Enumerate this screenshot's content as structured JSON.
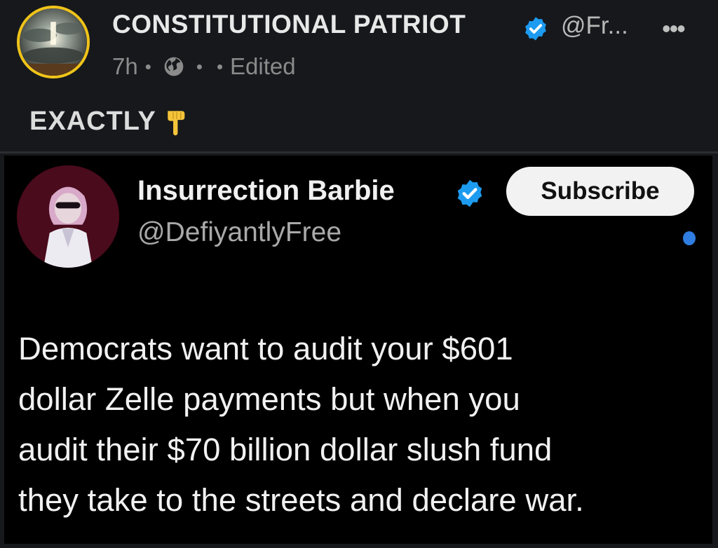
{
  "post": {
    "author_name": "CONSTITUTIONAL PATRIOT",
    "handle": "@Fr...",
    "time": "7h",
    "status": "Edited",
    "text": "EXACTLY",
    "icons": [
      "avatar",
      "verified-badge-icon",
      "more-icon",
      "globe-icon",
      "pointing-down-hand-icon"
    ]
  },
  "embed": {
    "author_name": "Insurrection Barbie",
    "handle": "@DefiyantlyFree",
    "subscribe_label": "Subscribe",
    "body_lines": [
      "Democrats want to audit your $601",
      "dollar Zelle payments but when you",
      "audit their $70 billion dollar slush fund",
      "they take to the streets and declare war."
    ]
  },
  "colors": {
    "background": "#16181c",
    "embed_background": "#000000",
    "avatar_ring": "#f0c419",
    "verified": "#1d9bf0",
    "accent_dot": "#2f7de1"
  }
}
